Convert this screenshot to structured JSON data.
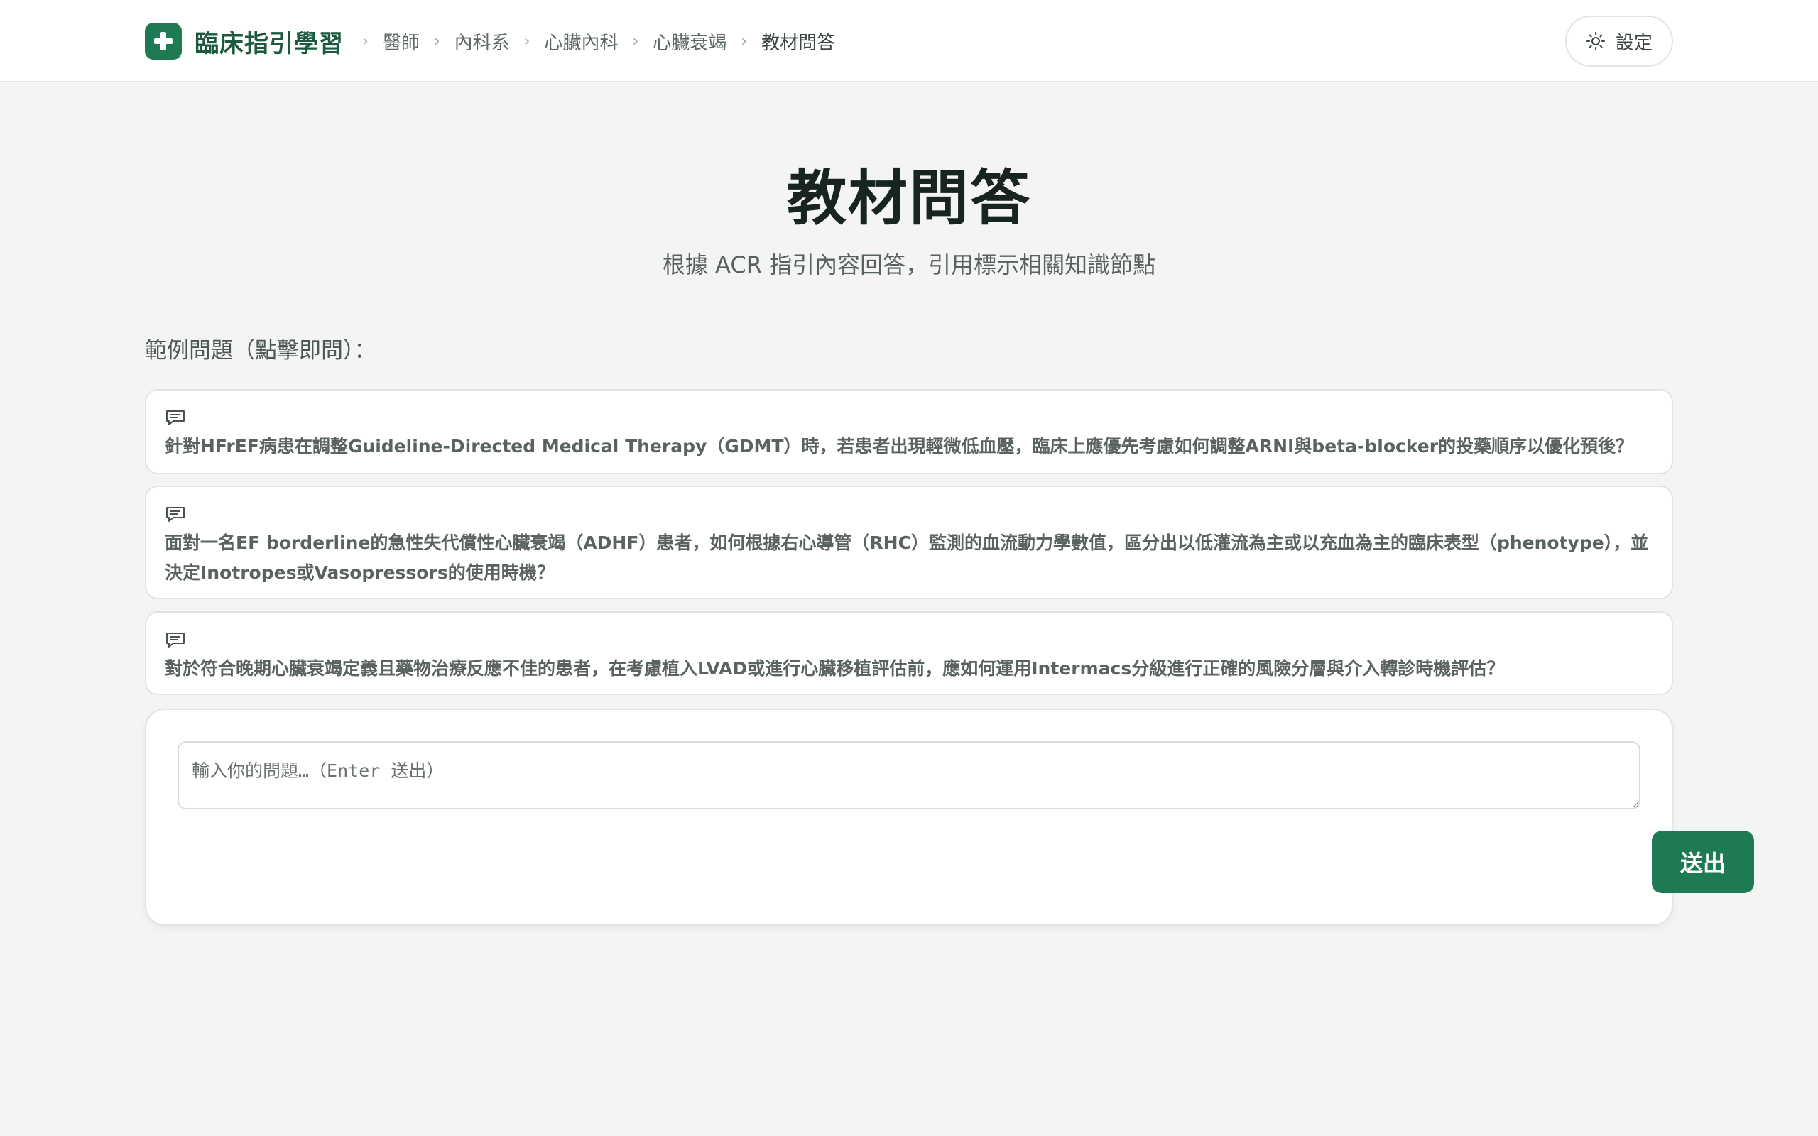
{
  "header": {
    "brand_title": "臨床指引學習",
    "breadcrumb": [
      {
        "label": "醫師"
      },
      {
        "label": "內科系"
      },
      {
        "label": "心臟內科"
      },
      {
        "label": "心臟衰竭"
      },
      {
        "label": "教材問答"
      }
    ],
    "settings_label": "設定"
  },
  "hero": {
    "title": "教材問答",
    "subtitle": "根據 ACR 指引內容回答，引用標示相關知識節點"
  },
  "examples": {
    "label": "範例問題（點擊即問）：",
    "items": [
      {
        "text": "針對HFrEF病患在調整Guideline-Directed Medical Therapy（GDMT）時，若患者出現輕微低血壓，臨床上應優先考慮如何調整ARNI與beta-blocker的投藥順序以優化預後？"
      },
      {
        "text": "面對一名EF borderline的急性失代償性心臟衰竭（ADHF）患者，如何根據右心導管（RHC）監測的血流動力學數值，區分出以低灌流為主或以充血為主的臨床表型（phenotype），並決定Inotropes或Vasopressors的使用時機？"
      },
      {
        "text": "對於符合晚期心臟衰竭定義且藥物治療反應不佳的患者，在考慮植入LVAD或進行心臟移植評估前，應如何運用Intermacs分級進行正確的風險分層與介入轉診時機評估？"
      }
    ]
  },
  "composer": {
    "placeholder": "輸入你的問題…（Enter 送出）",
    "value": "",
    "send_label": "送出"
  },
  "colors": {
    "brand": "#1e7a52",
    "background": "#f3f4f3",
    "card": "#ffffff"
  },
  "icons": {
    "logo": "plus-icon",
    "settings": "sun-icon",
    "example": "chat-bubble-icon"
  }
}
